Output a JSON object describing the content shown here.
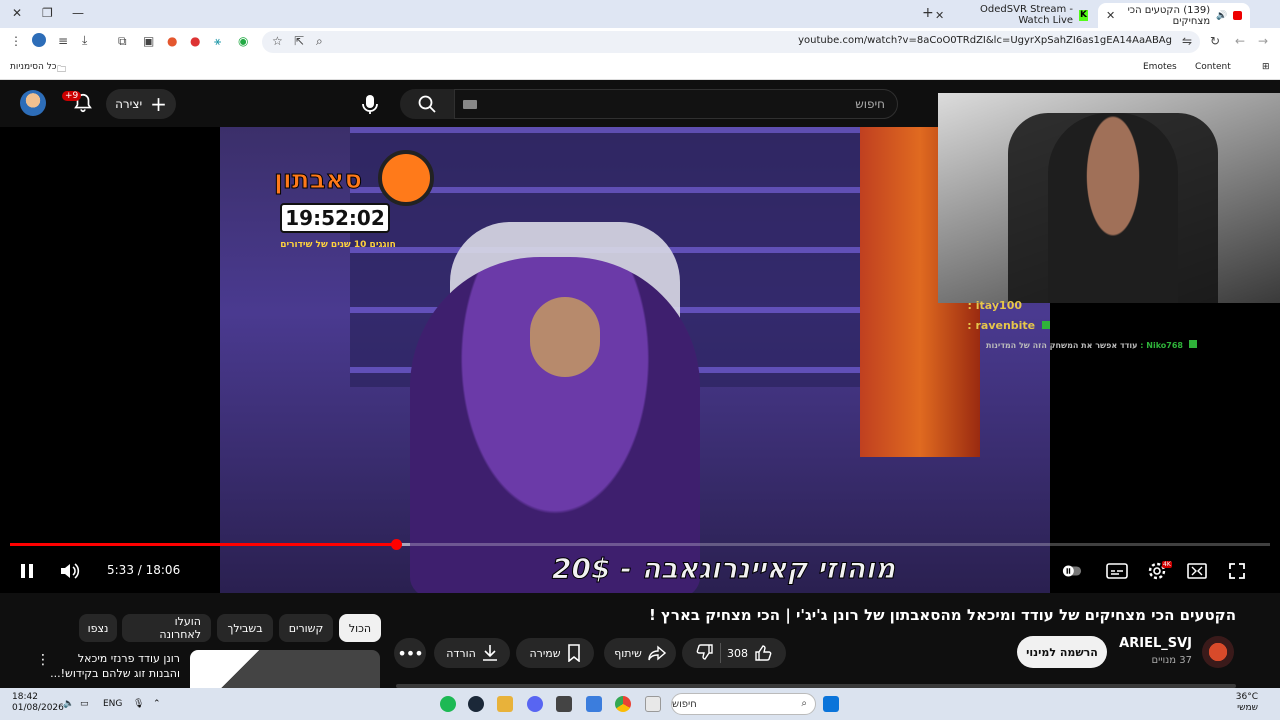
{
  "browser": {
    "active_tab_title": "(139) הקטעים הכי מצחיקים",
    "other_tab_title": "OdedSVR Stream - Watch Live",
    "url": "youtube.com/watch?v=8aCoO0TRdZI&lc=UgyrXpSahZI6as1gEA14AaABAg",
    "bookmarks": {
      "all_bookmarks": "כל הסימניות",
      "emotes": "Emotes",
      "content": "Content"
    }
  },
  "youtube_header": {
    "notification_count": "+9",
    "create_label": "יצירה",
    "search_placeholder": "חיפוש"
  },
  "video": {
    "logo_title": "סאבתון",
    "timer_value": "19:52:02",
    "logo_subtitle": "חוגגים 10 שנים של שידורים",
    "subtitle_text": "מוהוזי קאיינרוגאבה - 20$",
    "current_time": "5:33",
    "duration": "18:06",
    "time_display": "5:33 / 18:06",
    "progress_fraction": 0.3066,
    "quality_badge": "4K",
    "chat": [
      {
        "user": "itay100",
        "message": ""
      },
      {
        "user": "ravenbite",
        "message": ""
      },
      {
        "user": "Niko768",
        "message": "עודד אפשר את המשחק הזה של המדינות"
      }
    ]
  },
  "details": {
    "title": "הקטעים הכי מצחיקים של עודד ומיכאל מהסאבתון של רונן ג'יג'י | הכי מצחיק בארץ !",
    "channel_name": "ARIEL_SVJ",
    "subscribers": "37 מנויים",
    "subscribe_label": "הרשמה למינוי",
    "like_count": "308",
    "share_label": "שיתוף",
    "save_label": "שמירה",
    "download_label": "הורדה"
  },
  "recommendations": {
    "chips": [
      "הכול",
      "קשורים",
      "בשבילך",
      "הועלו לאחרונה",
      "נצפו"
    ],
    "first_title": "רונן עודד פרנזי מיכאל והבנות זוג שלהם בקידוש!..."
  },
  "taskbar": {
    "time": "18:42",
    "date": "01/08/2026",
    "language": "ENG",
    "search_label": "חיפוש",
    "temperature": "36°C",
    "weather": "שמשי"
  },
  "colors": {
    "yt_red": "#ff0000",
    "background": "#0f0f0f",
    "chip_active": "#f1f1f1"
  }
}
